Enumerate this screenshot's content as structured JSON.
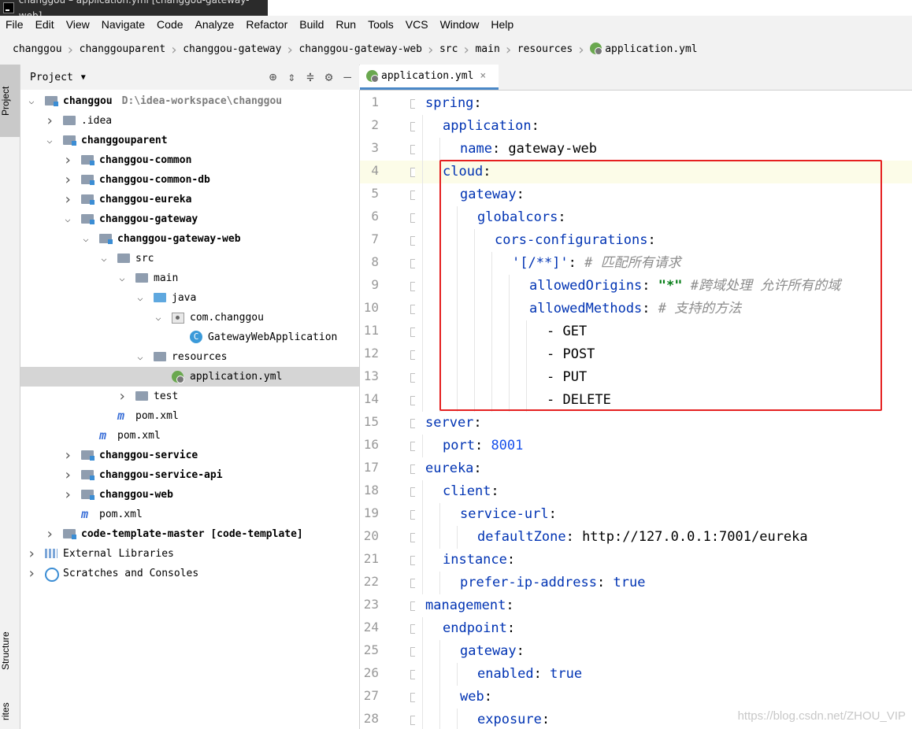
{
  "window": {
    "title": "changgou – application.yml [changgou-gateway-web]"
  },
  "menu": [
    "File",
    "Edit",
    "View",
    "Navigate",
    "Code",
    "Analyze",
    "Refactor",
    "Build",
    "Run",
    "Tools",
    "VCS",
    "Window",
    "Help"
  ],
  "breadcrumb": [
    "changgou",
    "changgouparent",
    "changgou-gateway",
    "changgou-gateway-web",
    "src",
    "main",
    "resources",
    "application.yml"
  ],
  "side_tabs": {
    "project": "Project",
    "structure": "Structure",
    "favorites": "rites"
  },
  "project_panel": {
    "title": "Project"
  },
  "tree": [
    {
      "label": "changgou",
      "path": "D:\\idea-workspace\\changgou",
      "arrow": "v",
      "indent": 0,
      "icon": "folder-mod",
      "bold": true
    },
    {
      "label": ".idea",
      "arrow": ">",
      "indent": 1,
      "icon": "folder"
    },
    {
      "label": "changgouparent",
      "arrow": "v",
      "indent": 1,
      "icon": "folder-mod",
      "bold": true
    },
    {
      "label": "changgou-common",
      "arrow": ">",
      "indent": 2,
      "icon": "folder-mod",
      "bold": true
    },
    {
      "label": "changgou-common-db",
      "arrow": ">",
      "indent": 2,
      "icon": "folder-mod",
      "bold": true
    },
    {
      "label": "changgou-eureka",
      "arrow": ">",
      "indent": 2,
      "icon": "folder-mod",
      "bold": true
    },
    {
      "label": "changgou-gateway",
      "arrow": "v",
      "indent": 2,
      "icon": "folder-mod",
      "bold": true
    },
    {
      "label": "changgou-gateway-web",
      "arrow": "v",
      "indent": 3,
      "icon": "folder-mod",
      "bold": true
    },
    {
      "label": "src",
      "arrow": "v",
      "indent": 4,
      "icon": "folder"
    },
    {
      "label": "main",
      "arrow": "v",
      "indent": 5,
      "icon": "folder"
    },
    {
      "label": "java",
      "arrow": "v",
      "indent": 6,
      "icon": "folder-blue"
    },
    {
      "label": "com.changgou",
      "arrow": "v",
      "indent": 7,
      "icon": "package"
    },
    {
      "label": "GatewayWebApplication",
      "arrow": "",
      "indent": 8,
      "icon": "class"
    },
    {
      "label": "resources",
      "arrow": "v",
      "indent": 6,
      "icon": "folder"
    },
    {
      "label": "application.yml",
      "arrow": "",
      "indent": 7,
      "icon": "yml",
      "selected": true
    },
    {
      "label": "test",
      "arrow": ">",
      "indent": 5,
      "icon": "folder"
    },
    {
      "label": "pom.xml",
      "arrow": "",
      "indent": 4,
      "icon": "maven"
    },
    {
      "label": "pom.xml",
      "arrow": "",
      "indent": 3,
      "icon": "maven"
    },
    {
      "label": "changgou-service",
      "arrow": ">",
      "indent": 2,
      "icon": "folder-mod",
      "bold": true
    },
    {
      "label": "changgou-service-api",
      "arrow": ">",
      "indent": 2,
      "icon": "folder-mod",
      "bold": true
    },
    {
      "label": "changgou-web",
      "arrow": ">",
      "indent": 2,
      "icon": "folder-mod",
      "bold": true
    },
    {
      "label": "pom.xml",
      "arrow": "",
      "indent": 2,
      "icon": "maven"
    },
    {
      "label": "code-template-master [code-template]",
      "arrow": ">",
      "indent": 1,
      "icon": "folder-mod",
      "bold": true
    },
    {
      "label": "External Libraries",
      "arrow": ">",
      "indent": 0,
      "icon": "library"
    },
    {
      "label": "Scratches and Consoles",
      "arrow": ">",
      "indent": 0,
      "icon": "scratch"
    }
  ],
  "editor_tab": {
    "label": "application.yml",
    "close": "×"
  },
  "code_lines": [
    {
      "n": 1,
      "indent": 0,
      "parts": [
        [
          "k",
          "spring"
        ],
        [
          "v",
          ":"
        ]
      ]
    },
    {
      "n": 2,
      "indent": 1,
      "parts": [
        [
          "k",
          "application"
        ],
        [
          "v",
          ":"
        ]
      ]
    },
    {
      "n": 3,
      "indent": 2,
      "parts": [
        [
          "k",
          "name"
        ],
        [
          "v",
          ": gateway-web"
        ]
      ]
    },
    {
      "n": 4,
      "indent": 1,
      "parts": [
        [
          "k",
          "cloud"
        ],
        [
          "v",
          ":"
        ]
      ],
      "current": true
    },
    {
      "n": 5,
      "indent": 2,
      "parts": [
        [
          "k",
          "gateway"
        ],
        [
          "v",
          ":"
        ]
      ]
    },
    {
      "n": 6,
      "indent": 3,
      "parts": [
        [
          "k",
          "globalcors"
        ],
        [
          "v",
          ":"
        ]
      ]
    },
    {
      "n": 7,
      "indent": 4,
      "parts": [
        [
          "k",
          "cors-configurations"
        ],
        [
          "v",
          ":"
        ]
      ]
    },
    {
      "n": 8,
      "indent": 5,
      "parts": [
        [
          "k",
          "'[/**]'"
        ],
        [
          "v",
          ": "
        ],
        [
          "c",
          "# 匹配所有请求"
        ]
      ]
    },
    {
      "n": 9,
      "indent": 6,
      "parts": [
        [
          "k",
          "allowedOrigins"
        ],
        [
          "v",
          ": "
        ],
        [
          "s",
          "\"*\""
        ],
        [
          "v",
          " "
        ],
        [
          "c",
          "#跨域处理 允许所有的域"
        ]
      ]
    },
    {
      "n": 10,
      "indent": 6,
      "parts": [
        [
          "k",
          "allowedMethods"
        ],
        [
          "v",
          ": "
        ],
        [
          "c",
          "# 支持的方法"
        ]
      ]
    },
    {
      "n": 11,
      "indent": 7,
      "parts": [
        [
          "v",
          "- GET"
        ]
      ]
    },
    {
      "n": 12,
      "indent": 7,
      "parts": [
        [
          "v",
          "- POST"
        ]
      ]
    },
    {
      "n": 13,
      "indent": 7,
      "parts": [
        [
          "v",
          "- PUT"
        ]
      ]
    },
    {
      "n": 14,
      "indent": 7,
      "parts": [
        [
          "v",
          "- DELETE"
        ]
      ]
    },
    {
      "n": 15,
      "indent": 0,
      "parts": [
        [
          "k",
          "server"
        ],
        [
          "v",
          ":"
        ]
      ]
    },
    {
      "n": 16,
      "indent": 1,
      "parts": [
        [
          "k",
          "port"
        ],
        [
          "v",
          ": "
        ],
        [
          "n",
          "8001"
        ]
      ]
    },
    {
      "n": 17,
      "indent": 0,
      "parts": [
        [
          "k",
          "eureka"
        ],
        [
          "v",
          ":"
        ]
      ]
    },
    {
      "n": 18,
      "indent": 1,
      "parts": [
        [
          "k",
          "client"
        ],
        [
          "v",
          ":"
        ]
      ]
    },
    {
      "n": 19,
      "indent": 2,
      "parts": [
        [
          "k",
          "service-url"
        ],
        [
          "v",
          ":"
        ]
      ]
    },
    {
      "n": 20,
      "indent": 3,
      "parts": [
        [
          "k",
          "defaultZone"
        ],
        [
          "v",
          ": http://127.0.0.1:7001/eureka"
        ]
      ]
    },
    {
      "n": 21,
      "indent": 1,
      "parts": [
        [
          "k",
          "instance"
        ],
        [
          "v",
          ":"
        ]
      ]
    },
    {
      "n": 22,
      "indent": 2,
      "parts": [
        [
          "k",
          "prefer-ip-address"
        ],
        [
          "v",
          ": "
        ],
        [
          "k",
          "true"
        ]
      ]
    },
    {
      "n": 23,
      "indent": 0,
      "parts": [
        [
          "k",
          "management"
        ],
        [
          "v",
          ":"
        ]
      ]
    },
    {
      "n": 24,
      "indent": 1,
      "parts": [
        [
          "k",
          "endpoint"
        ],
        [
          "v",
          ":"
        ]
      ]
    },
    {
      "n": 25,
      "indent": 2,
      "parts": [
        [
          "k",
          "gateway"
        ],
        [
          "v",
          ":"
        ]
      ]
    },
    {
      "n": 26,
      "indent": 3,
      "parts": [
        [
          "k",
          "enabled"
        ],
        [
          "v",
          ": "
        ],
        [
          "k",
          "true"
        ]
      ]
    },
    {
      "n": 27,
      "indent": 2,
      "parts": [
        [
          "k",
          "web"
        ],
        [
          "v",
          ":"
        ]
      ]
    },
    {
      "n": 28,
      "indent": 3,
      "parts": [
        [
          "k",
          "exposure"
        ],
        [
          "v",
          ":"
        ]
      ]
    }
  ],
  "watermark": "https://blog.csdn.net/ZHOU_VIP",
  "colors": {
    "highlight_box": "#e52020",
    "selection": "#d5d5d5",
    "keyword": "#0033b3",
    "string": "#067d17",
    "number": "#1750eb"
  }
}
